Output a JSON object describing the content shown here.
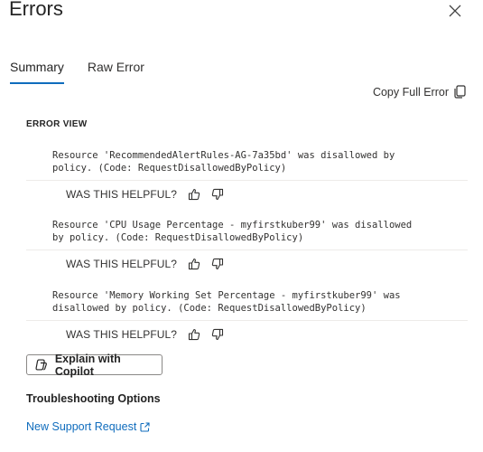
{
  "panel": {
    "title": "Errors"
  },
  "tabs": [
    {
      "label": "Summary",
      "active": true
    },
    {
      "label": "Raw Error",
      "active": false
    }
  ],
  "toolbar": {
    "copy_label": "Copy Full Error"
  },
  "error_view": {
    "label": "ERROR VIEW",
    "helpful_label": "WAS THIS HELPFUL?",
    "errors": [
      {
        "message": "Resource 'RecommendedAlertRules-AG-7a35bd' was disallowed by\npolicy. (Code: RequestDisallowedByPolicy)"
      },
      {
        "message": "Resource 'CPU Usage Percentage - myfirstkuber99' was disallowed\nby policy. (Code: RequestDisallowedByPolicy)"
      },
      {
        "message": "Resource 'Memory Working Set Percentage - myfirstkuber99' was\ndisallowed by policy. (Code: RequestDisallowedByPolicy)"
      }
    ]
  },
  "copilot": {
    "label": "Explain with Copilot"
  },
  "troubleshooting": {
    "heading": "Troubleshooting Options",
    "link_label": "New Support Request"
  },
  "colors": {
    "accent": "#0f6cbd",
    "divider": "#edebe9",
    "border": "#8a8886"
  },
  "icons": [
    "close-icon",
    "copy-icon",
    "thumbs-up-icon",
    "thumbs-down-icon",
    "copilot-icon",
    "external-link-icon"
  ]
}
